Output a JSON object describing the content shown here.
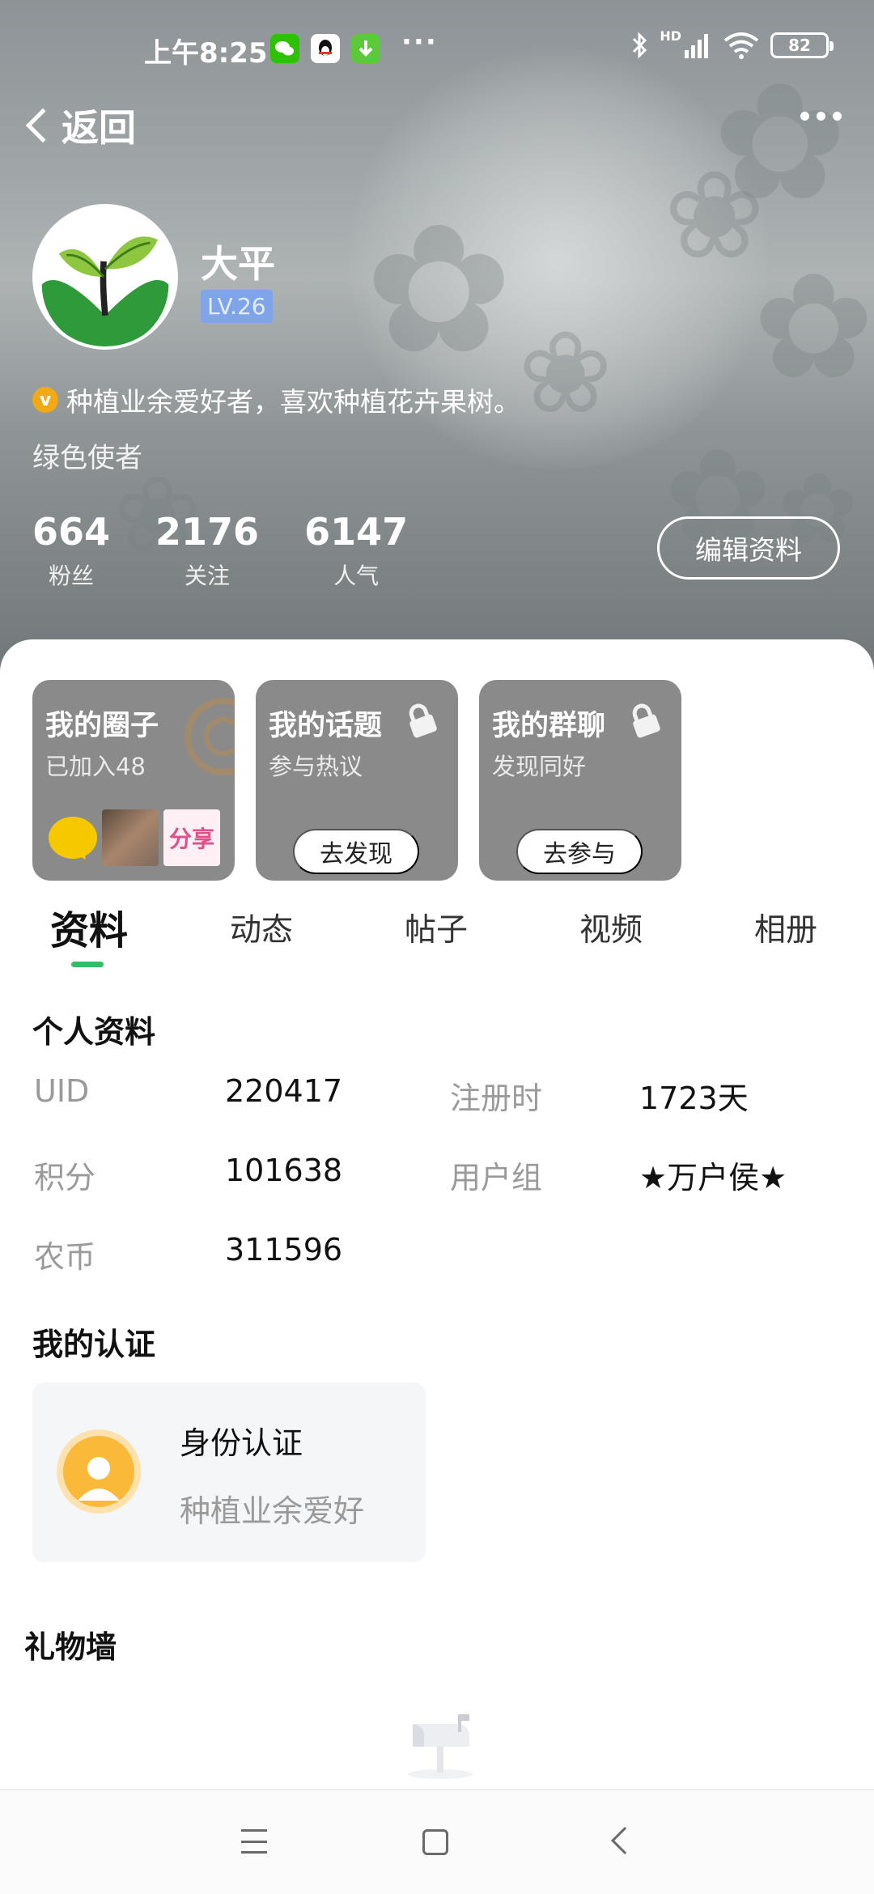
{
  "status_bar": {
    "time": "上午8:25",
    "app_icons": [
      "wechat-icon",
      "qq-icon",
      "download-icon"
    ],
    "more": "···",
    "network": "HD",
    "battery": "82"
  },
  "header": {
    "back_label": "返回",
    "menu_icon": "more-dots-icon"
  },
  "profile": {
    "nickname": "大平",
    "level": "LV.26",
    "signature": "种植业余爱好者，喜欢种植花卉果树。",
    "title": "绿色使者",
    "stats": [
      {
        "value": "664",
        "label": "粉丝"
      },
      {
        "value": "2176",
        "label": "关注"
      },
      {
        "value": "6147",
        "label": "人气"
      }
    ],
    "edit_button": "编辑资料"
  },
  "cards": [
    {
      "title": "我的圈子",
      "subtitle": "已加入48"
    },
    {
      "title": "我的话题",
      "subtitle": "参与热议",
      "button": "去发现"
    },
    {
      "title": "我的群聊",
      "subtitle": "发现同好",
      "button": "去参与"
    }
  ],
  "share_thumb_text": "分享",
  "tabs": [
    "资料",
    "动态",
    "帖子",
    "视频",
    "相册"
  ],
  "active_tab": "资料",
  "personal_info": {
    "heading": "个人资料",
    "rows": [
      {
        "label": "UID",
        "value": "220417"
      },
      {
        "label": "注册时",
        "value": "1723天"
      },
      {
        "label": "积分",
        "value": "101638"
      },
      {
        "label": "用户组",
        "value": "★万户侯★"
      },
      {
        "label": "农币",
        "value": "311596"
      }
    ]
  },
  "certification": {
    "heading": "我的认证",
    "title": "身份认证",
    "subtitle": "种植业余爱好"
  },
  "gift_wall": {
    "heading": "礼物墙"
  },
  "colors": {
    "accent_green": "#2fbf67",
    "level_badge": "#7fa4e8",
    "card_gray": "#8a8a8a",
    "cert_orange": "#fbb93a"
  }
}
